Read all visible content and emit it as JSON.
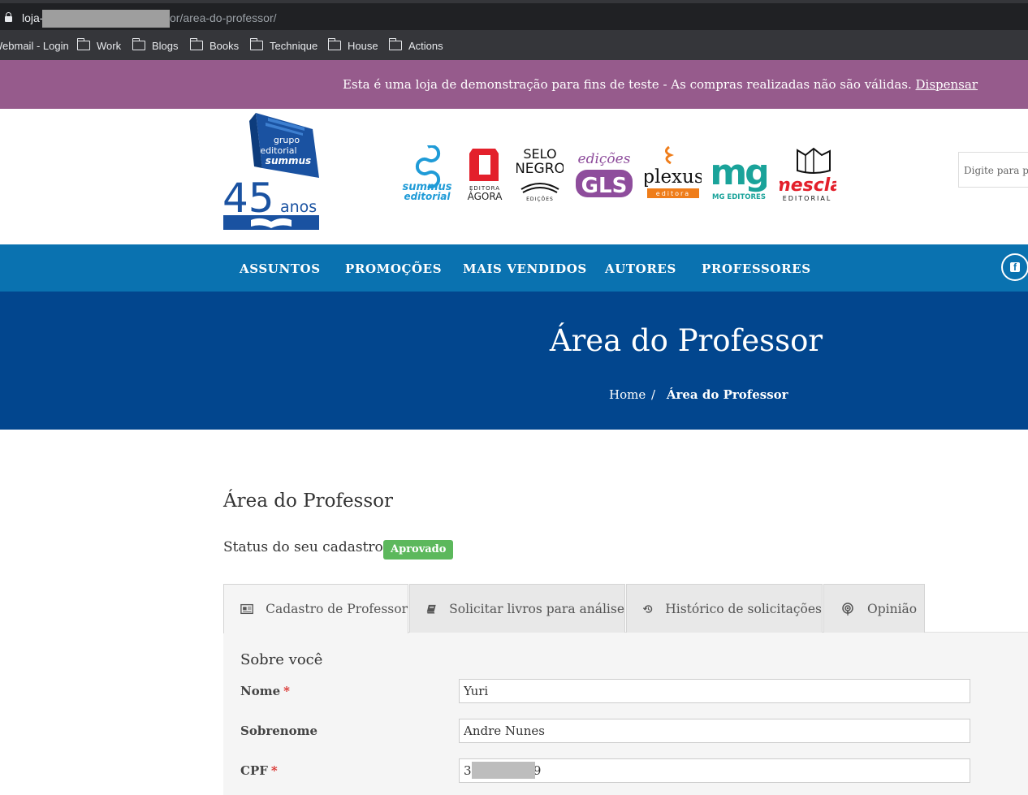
{
  "browser": {
    "url_host": "loja-",
    "url_path": "or/area-do-professor/",
    "bookmarks": [
      {
        "label": "Webmail - Login",
        "folder": false
      },
      {
        "label": "Work",
        "folder": true
      },
      {
        "label": "Blogs",
        "folder": true
      },
      {
        "label": "Books",
        "folder": true
      },
      {
        "label": "Technique",
        "folder": true
      },
      {
        "label": "House",
        "folder": true
      },
      {
        "label": "Actions",
        "folder": true
      }
    ]
  },
  "notice": {
    "text": "Esta é uma loja de demonstração para fins de teste - As compras realizadas não são válidas.",
    "dismiss": "Dispensar"
  },
  "header": {
    "logo": {
      "line1": "grupo",
      "line2": "editorial",
      "line3": "summus",
      "number": "45",
      "suffix": "anos"
    },
    "brands": {
      "summus": {
        "line1": "summus",
        "line2": "editorial"
      },
      "agora": {
        "line1": "EDITORA",
        "line2": "ÁGORA"
      },
      "selo": {
        "line1": "SELO",
        "line2": "NEGRO",
        "line3": "EDIÇÕES"
      },
      "gls": {
        "line1": "edições",
        "line2": "GLS"
      },
      "plexus": {
        "line1": "plexus",
        "line2": "editora"
      },
      "mg": {
        "line1": "mg",
        "line2": "MG EDITORES"
      },
      "mescla": {
        "line1": "mescla",
        "line2": "EDITORIAL"
      }
    },
    "search_placeholder": "Digite para pes"
  },
  "nav": {
    "items": [
      "ASSUNTOS",
      "PROMOÇÕES",
      "MAIS VENDIDOS",
      "AUTORES",
      "PROFESSORES"
    ]
  },
  "hero": {
    "title": "Área do Professor",
    "breadcrumb": {
      "home": "Home",
      "separator": "/",
      "current": "Área do Professor"
    }
  },
  "content": {
    "title": "Área do Professor",
    "status_label": "Status do seu cadastro:",
    "status_badge": "Aprovado",
    "tabs": [
      {
        "label": "Cadastro de Professor",
        "icon": "profile-card-icon",
        "active": true
      },
      {
        "label": "Solicitar livros para análise",
        "icon": "book-icon",
        "active": false
      },
      {
        "label": "Histórico de solicitações",
        "icon": "history-icon",
        "active": false
      },
      {
        "label": "Opinião",
        "icon": "podcast-icon",
        "active": false
      }
    ],
    "section_title": "Sobre você",
    "fields": [
      {
        "label": "Nome",
        "required": true,
        "value": "Yuri"
      },
      {
        "label": "Sobrenome",
        "required": false,
        "value": "Andre Nunes"
      },
      {
        "label": "CPF",
        "required": true,
        "value": "39            79"
      }
    ]
  },
  "colors": {
    "notice_bg": "#965b8c",
    "nav_bg": "#0a72b0",
    "hero_bg": "#02468e",
    "badge_green": "#5cb85c",
    "required_red": "#d9302c"
  }
}
